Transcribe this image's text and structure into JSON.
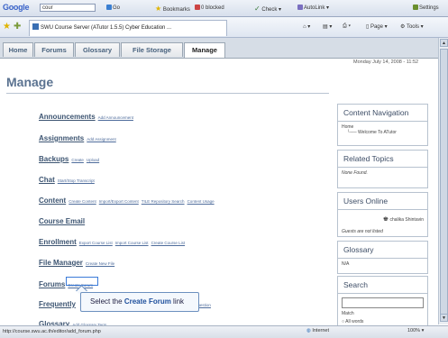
{
  "google_toolbar": {
    "logo": "Google",
    "search_value": "cour",
    "go_label": "Go",
    "bookmarks": "Bookmarks",
    "blocked": "0 blocked",
    "check": "Check",
    "autolink": "AutoLink",
    "settings": "Settings"
  },
  "ie_bar": {
    "tab_title": "SWU Course Server (ATutor 1.5.5) Cyber Education ...",
    "page_menu": "Page",
    "tools_menu": "Tools"
  },
  "site_tabs": [
    {
      "label": "Home"
    },
    {
      "label": "Forums"
    },
    {
      "label": "Glossary"
    },
    {
      "label": "File Storage"
    },
    {
      "label": "Manage"
    }
  ],
  "date_text": "Monday July 14, 2008 - 11:52",
  "page_title": "Manage",
  "manage_items": [
    {
      "name": "Announcements",
      "links": [
        "Add Announcement"
      ]
    },
    {
      "name": "Assignments",
      "links": [
        "Add Assignment"
      ]
    },
    {
      "name": "Backups",
      "links": [
        "Create",
        "Upload"
      ]
    },
    {
      "name": "Chat",
      "links": [
        "Start/Stop Transcript"
      ]
    },
    {
      "name": "Content",
      "links": [
        "Create Content",
        "Import/Export Content",
        "TILE Repository Search",
        "Content Usage"
      ]
    },
    {
      "name": "Course Email",
      "links": []
    },
    {
      "name": "Enrollment",
      "links": [
        "Export Course List",
        "Import Course List",
        "Create Course List"
      ]
    },
    {
      "name": "File Manager",
      "links": [
        "Create New File"
      ]
    },
    {
      "name": "Forums",
      "links": [
        "Create Forum"
      ]
    },
    {
      "name": "Frequently",
      "links": [
        "Question"
      ]
    },
    {
      "name": "Glossary",
      "links": [
        "Add Glossary Term"
      ]
    }
  ],
  "sidebar": {
    "content_nav": {
      "title": "Content Navigation",
      "home": "Home",
      "item": "Welcome To ATutor"
    },
    "related": {
      "title": "Related Topics",
      "body": "None Found."
    },
    "users_online": {
      "title": "Users Online",
      "user": "chalika Shintavin",
      "guests": "Guests are not listed"
    },
    "glossary": {
      "title": "Glossary",
      "body": "N/A"
    },
    "search": {
      "title": "Search",
      "match_label": "Match",
      "option": "All words"
    }
  },
  "callout": {
    "prefix": "Select the ",
    "bold": "Create Forum",
    "suffix": " link"
  },
  "status": {
    "url": "http://course.swu.ac.th/editor/add_forum.php",
    "zone": "Internet",
    "zoom": "100%"
  }
}
